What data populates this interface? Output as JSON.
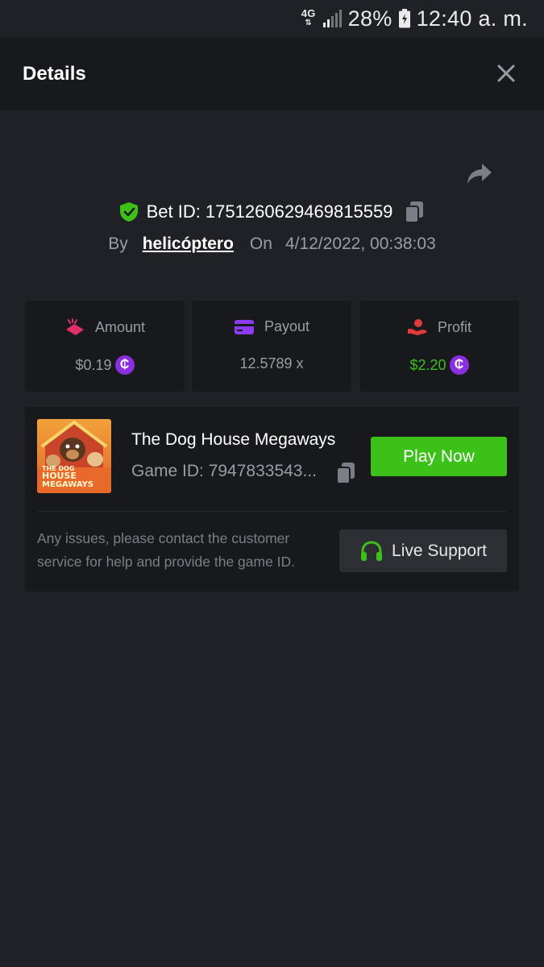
{
  "status_bar": {
    "network": "4G",
    "battery": "28%",
    "time": "12:40 a. m."
  },
  "header": {
    "title": "Details"
  },
  "bet": {
    "id_label": "Bet ID: 1751260629469815559",
    "by_label": "By",
    "user": "helicóptero",
    "on_label": "On",
    "datetime": "4/12/2022, 00:38:03"
  },
  "stats": {
    "amount": {
      "label": "Amount",
      "value": "$0.19"
    },
    "payout": {
      "label": "Payout",
      "value": "12.5789 x"
    },
    "profit": {
      "label": "Profit",
      "value": "$2.20"
    }
  },
  "coin_symbol": "₵",
  "game": {
    "title": "The Dog House Megaways",
    "id_label": "Game ID: 7947833543...",
    "thumb_text": {
      "line1": "THE DOG",
      "line2": "HOUSE",
      "line3": "MEGAWAYS"
    },
    "play_label": "Play Now",
    "issues_text": "Any issues, please contact the customer service for help and provide the game ID.",
    "support_label": "Live Support"
  },
  "colors": {
    "background": "#202126",
    "card": "#18191d",
    "accent_green": "#3bc117",
    "coin_purple": "#8a2fe0",
    "amount_icon": "#e0306a",
    "payout_icon": "#8b3cf0",
    "profit_icon": "#e03a3a"
  },
  "icons": [
    "shield-check-icon",
    "copy-icon",
    "share-icon",
    "close-icon",
    "amount-icon",
    "wallet-card-icon",
    "hand-money-icon",
    "coin-icon",
    "headset-icon"
  ]
}
